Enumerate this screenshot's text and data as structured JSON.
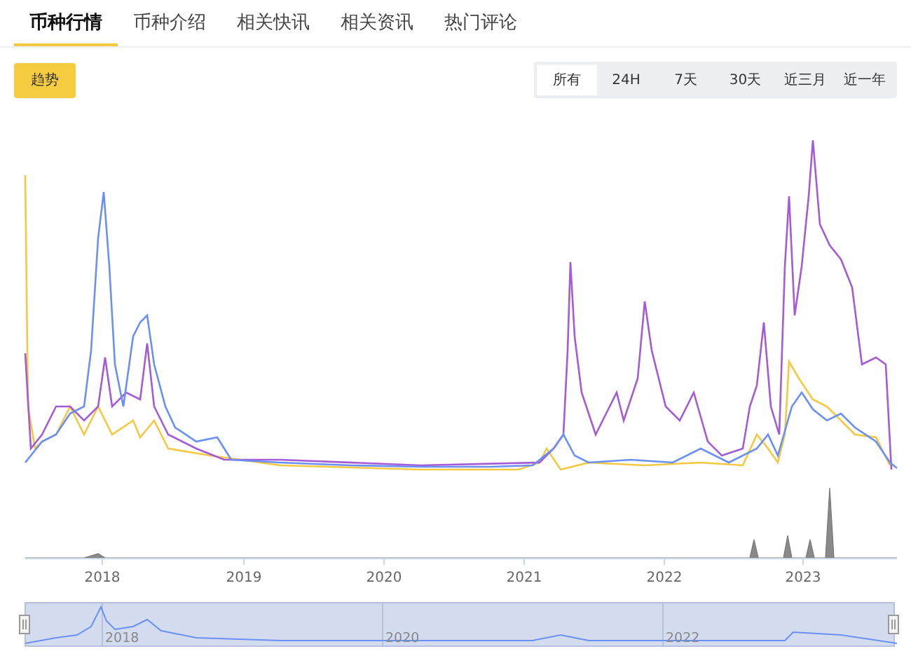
{
  "tabs": [
    {
      "label": "币种行情",
      "selected": true
    },
    {
      "label": "币种介绍",
      "selected": false
    },
    {
      "label": "相关快讯",
      "selected": false
    },
    {
      "label": "相关资讯",
      "selected": false
    },
    {
      "label": "热门评论",
      "selected": false
    }
  ],
  "trend_button": "趋势",
  "ranges": [
    {
      "label": "所有",
      "selected": true
    },
    {
      "label": "24H",
      "selected": false
    },
    {
      "label": "7天",
      "selected": false
    },
    {
      "label": "30天",
      "selected": false
    },
    {
      "label": "近三月",
      "selected": false
    },
    {
      "label": "近一年",
      "selected": false
    }
  ],
  "x_axis": [
    "2018",
    "2019",
    "2020",
    "2021",
    "2022",
    "2023"
  ],
  "navigator_labels": [
    "2018",
    "2020",
    "2022"
  ]
}
